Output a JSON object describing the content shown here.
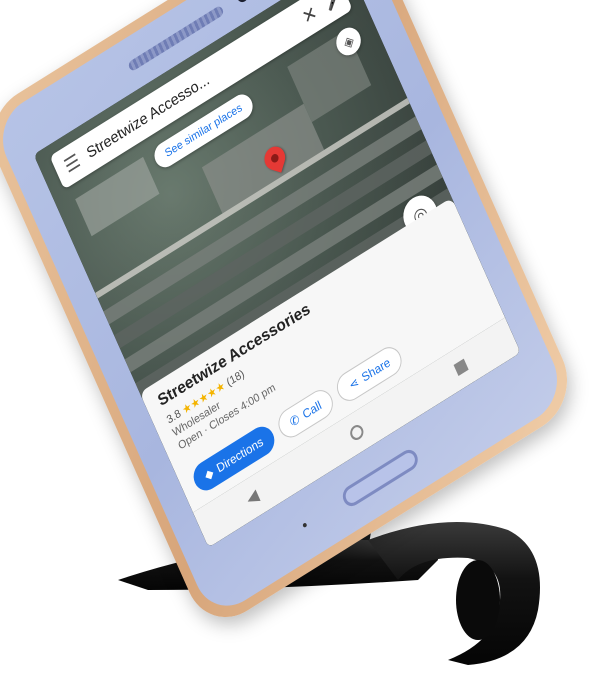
{
  "search": {
    "query": "Streetwize Accesso...",
    "menu_icon": "hamburger-menu-icon",
    "close_icon": "close-icon",
    "mic_icon": "microphone-icon"
  },
  "map": {
    "chip_label": "See similar places",
    "pin_icon": "map-pin-icon",
    "layers_icon": "layers-icon",
    "locate_icon": "my-location-icon"
  },
  "place": {
    "name": "Streetwize Accessories",
    "rating": "3.8",
    "stars": "★★★★★",
    "review_count": "(18)",
    "category": "Wholesaler",
    "hours": "Open · Closes 4:00 pm"
  },
  "actions": {
    "directions": "Directions",
    "call": "Call",
    "share": "Share"
  },
  "nav": {
    "back": "◀",
    "recents": "■"
  },
  "colors": {
    "accent": "#1a73e8",
    "pin": "#e53935",
    "phone_trim": "#d9a77c",
    "phone_front": "#aeb9e1",
    "holder": "#141414"
  }
}
